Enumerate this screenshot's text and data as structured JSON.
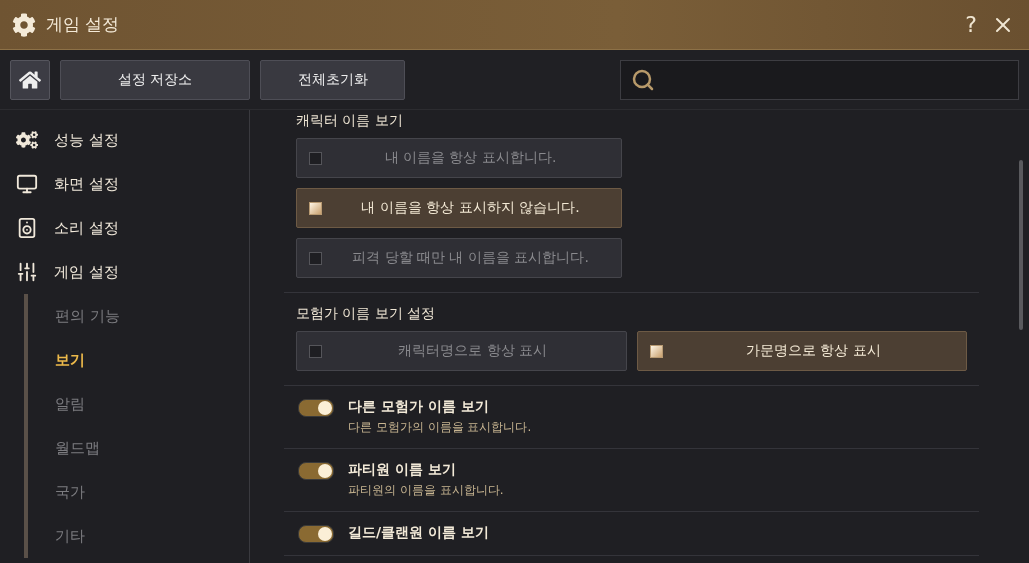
{
  "window": {
    "title": "게임 설정",
    "help": "?"
  },
  "toolbar": {
    "buttons": [
      "설정 저장소",
      "전체초기화"
    ]
  },
  "sidebar": {
    "items": [
      {
        "label": "성능 설정"
      },
      {
        "label": "화면 설정"
      },
      {
        "label": "소리 설정"
      },
      {
        "label": "게임 설정",
        "children": [
          {
            "label": "편의 기능",
            "selected": false
          },
          {
            "label": "보기",
            "selected": true
          },
          {
            "label": "알림",
            "selected": false
          },
          {
            "label": "월드맵",
            "selected": false
          },
          {
            "label": "국가",
            "selected": false
          },
          {
            "label": "기타",
            "selected": false
          }
        ]
      }
    ]
  },
  "sections": [
    {
      "kind": "choice",
      "title": "캐릭터 이름 보기",
      "options": [
        {
          "label": "내 이름을 항상 표시합니다.",
          "selected": false
        },
        {
          "label": "내 이름을 항상 표시하지 않습니다.",
          "selected": true
        },
        {
          "label": "피격 당할 때만 내 이름을 표시합니다.",
          "selected": false
        }
      ]
    },
    {
      "kind": "choice",
      "title": "모험가 이름 보기 설정",
      "options": [
        {
          "label": "캐릭터명으로 항상 표시",
          "selected": false
        },
        {
          "label": "가문명으로 항상 표시",
          "selected": true
        }
      ]
    },
    {
      "kind": "toggle",
      "title": "다른 모험가 이름 보기",
      "description": "다른 모험가의 이름을 표시합니다.",
      "on": true
    },
    {
      "kind": "toggle",
      "title": "파티원 이름 보기",
      "description": "파티원의 이름을 표시합니다.",
      "on": true
    },
    {
      "kind": "toggle",
      "title": "길드/클랜원 이름 보기",
      "on": true
    }
  ]
}
